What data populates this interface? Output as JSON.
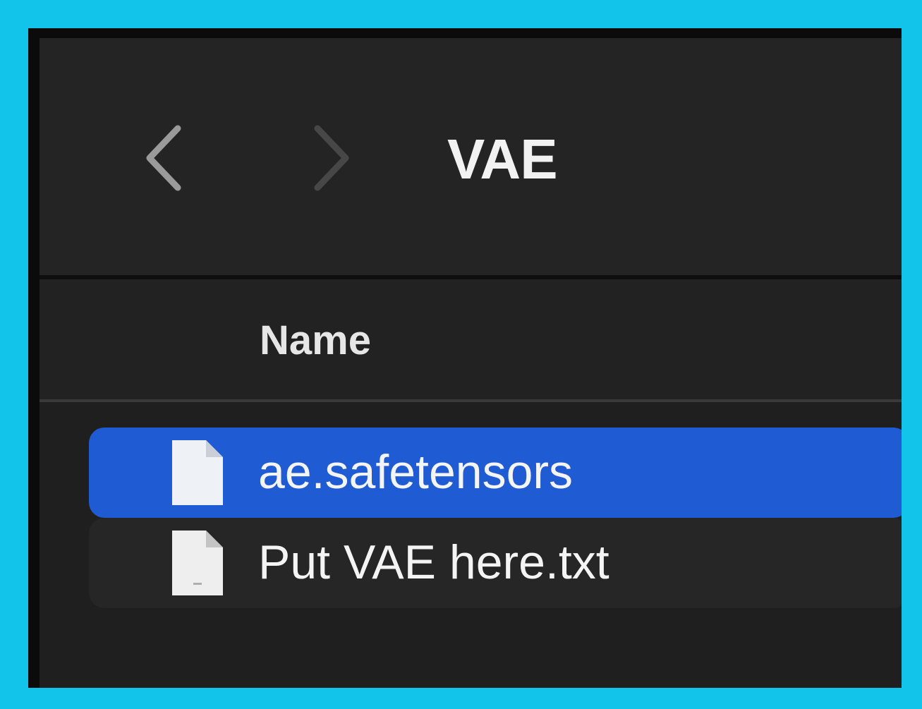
{
  "window": {
    "title": "VAE"
  },
  "toolbar": {
    "back_icon": "chevron-left-icon",
    "forward_icon": "chevron-right-icon"
  },
  "header": {
    "name_column": "Name"
  },
  "files": [
    {
      "name": "ae.safetensors",
      "icon": "document-icon",
      "selected": true
    },
    {
      "name": "Put VAE here.txt",
      "icon": "text-document-icon",
      "selected": false
    }
  ],
  "colors": {
    "frame_border": "#12c3ea",
    "selection": "#1f5bd3",
    "background": "#1f1f1f"
  }
}
